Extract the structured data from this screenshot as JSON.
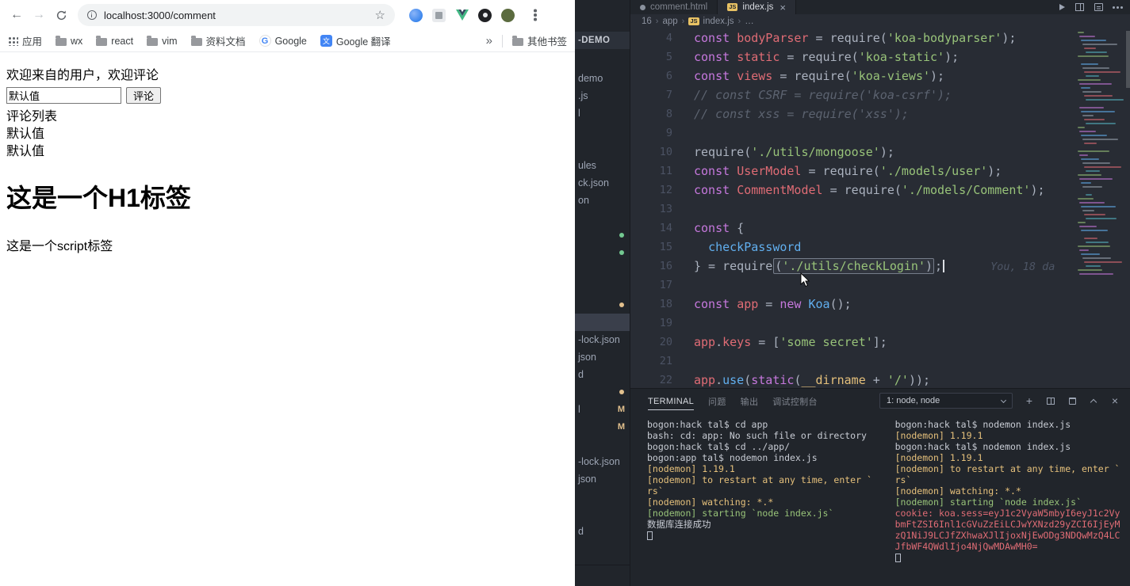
{
  "browser": {
    "toolbar": {
      "back": "←",
      "forward": "→",
      "star": "☆"
    },
    "url": "localhost:3000/comment",
    "extensions": [
      "blue-circle-extension",
      "gray-square-extension",
      "vue-devtools",
      "dark-extension",
      "profile-avatar"
    ],
    "bookmarks": {
      "items": [
        {
          "type": "apps",
          "label": "应用"
        },
        {
          "type": "folder",
          "label": "wx"
        },
        {
          "type": "folder",
          "label": "react"
        },
        {
          "type": "folder",
          "label": "vim"
        },
        {
          "type": "folder",
          "label": "资料文档"
        },
        {
          "type": "google",
          "label": "Google"
        },
        {
          "type": "translate",
          "label": "Google 翻译"
        }
      ],
      "icon_glyphs": {
        "google": "G",
        "translate": "文"
      },
      "overflow": "»",
      "others_label": "其他书签"
    },
    "page": {
      "welcome": "欢迎来自的用户，欢迎评论",
      "input_value": "默认值",
      "comment_button": "评论",
      "list_title": "评论列表",
      "comments": [
        "默认值",
        "默认值"
      ],
      "h1": "这是一个H1标签",
      "script_text": "这是一个script标签"
    }
  },
  "vscode": {
    "sidebar": {
      "header": "-DEMO",
      "rows": [
        {
          "label": "demo"
        },
        {
          "label": ".js"
        },
        {
          "label": "l"
        },
        {
          "label": ""
        },
        {
          "label": ""
        },
        {
          "label": "ules"
        },
        {
          "label": "ck.json"
        },
        {
          "label": "on"
        },
        {
          "label": ""
        },
        {
          "label": "",
          "marker": "green"
        },
        {
          "label": "",
          "marker": "green"
        },
        {
          "label": ""
        },
        {
          "label": ""
        },
        {
          "label": "",
          "marker": "yellow"
        },
        {
          "label": "",
          "selected": true
        },
        {
          "label": "-lock.json"
        },
        {
          "label": "json"
        },
        {
          "label": "d"
        },
        {
          "label": "",
          "marker": "yellow"
        },
        {
          "label": "l",
          "marker": "M"
        },
        {
          "label": "",
          "marker": "M"
        },
        {
          "label": ""
        },
        {
          "label": "-lock.json"
        },
        {
          "label": "json"
        },
        {
          "label": ""
        },
        {
          "label": ""
        },
        {
          "label": "d"
        },
        {
          "label": ""
        }
      ]
    },
    "tabs": [
      {
        "label": "comment.html",
        "icon": "dot",
        "active": false
      },
      {
        "label": "index.js",
        "icon": "js",
        "active": true,
        "close": "×"
      }
    ],
    "breadcrumb": {
      "sep": "›",
      "items": [
        "16",
        "app"
      ],
      "file_icon": "JS",
      "file": "index.js",
      "more": "…"
    },
    "editor": {
      "lines": [
        {
          "num": 4,
          "tokens": [
            [
              "kw",
              "const"
            ],
            [
              "d",
              " "
            ],
            [
              "v",
              "bodyParser"
            ],
            [
              "d",
              " = require("
            ],
            [
              "s",
              "'koa-bodyparser'"
            ],
            [
              "d",
              ");"
            ]
          ]
        },
        {
          "num": 5,
          "tokens": [
            [
              "kw",
              "const"
            ],
            [
              "d",
              " "
            ],
            [
              "v",
              "static"
            ],
            [
              "d",
              " = require("
            ],
            [
              "s",
              "'koa-static'"
            ],
            [
              "d",
              ");"
            ]
          ]
        },
        {
          "num": 6,
          "tokens": [
            [
              "kw",
              "const"
            ],
            [
              "d",
              " "
            ],
            [
              "v",
              "views"
            ],
            [
              "d",
              " = require("
            ],
            [
              "s",
              "'koa-views'"
            ],
            [
              "d",
              ");"
            ]
          ]
        },
        {
          "num": 7,
          "tokens": [
            [
              "c",
              "// const CSRF = require('koa-csrf');"
            ]
          ]
        },
        {
          "num": 8,
          "tokens": [
            [
              "c",
              "// const xss = require('xss');"
            ]
          ]
        },
        {
          "num": 9,
          "tokens": []
        },
        {
          "num": 10,
          "tokens": [
            [
              "d",
              "require("
            ],
            [
              "s",
              "'./utils/mongoose'"
            ],
            [
              "d",
              ");"
            ]
          ]
        },
        {
          "num": 11,
          "tokens": [
            [
              "kw",
              "const"
            ],
            [
              "d",
              " "
            ],
            [
              "v",
              "UserModel"
            ],
            [
              "d",
              " = require("
            ],
            [
              "s",
              "'./models/user'"
            ],
            [
              "d",
              ");"
            ]
          ]
        },
        {
          "num": 12,
          "tokens": [
            [
              "kw",
              "const"
            ],
            [
              "d",
              " "
            ],
            [
              "v",
              "CommentModel"
            ],
            [
              "d",
              " = require("
            ],
            [
              "s",
              "'./models/Comment'"
            ],
            [
              "d",
              ");"
            ]
          ]
        },
        {
          "num": 13,
          "tokens": []
        },
        {
          "num": 14,
          "tokens": [
            [
              "kw",
              "const"
            ],
            [
              "d",
              " {"
            ]
          ]
        },
        {
          "num": 15,
          "tokens": [
            [
              "d",
              "  "
            ],
            [
              "fn",
              "checkPassword"
            ]
          ]
        },
        {
          "num": 16,
          "tokens": [
            [
              "d",
              "} = require"
            ],
            [
              "grp",
              [
                [
                  "d",
                  "("
                ],
                [
                  "s",
                  "'./utils/checkLogin'"
                ],
                [
                  "d",
                  ")"
                ]
              ]
            ],
            [
              "d",
              ";"
            ],
            [
              "caret",
              ""
            ],
            [
              "blame",
              "You, 18 da"
            ]
          ]
        },
        {
          "num": 17,
          "tokens": []
        },
        {
          "num": 18,
          "tokens": [
            [
              "kw",
              "const"
            ],
            [
              "d",
              " "
            ],
            [
              "v",
              "app"
            ],
            [
              "d",
              " = "
            ],
            [
              "kw",
              "new"
            ],
            [
              "d",
              " "
            ],
            [
              "fn",
              "Koa"
            ],
            [
              "d",
              "();"
            ]
          ]
        },
        {
          "num": 19,
          "tokens": []
        },
        {
          "num": 20,
          "tokens": [
            [
              "v",
              "app"
            ],
            [
              "d",
              "."
            ],
            [
              "v",
              "keys"
            ],
            [
              "d",
              " = ["
            ],
            [
              "s",
              "'some secret'"
            ],
            [
              "d",
              "];"
            ]
          ]
        },
        {
          "num": 21,
          "tokens": []
        },
        {
          "num": 22,
          "tokens": [
            [
              "v",
              "app"
            ],
            [
              "d",
              "."
            ],
            [
              "fn",
              "use"
            ],
            [
              "d",
              "("
            ],
            [
              "kw",
              "static"
            ],
            [
              "d",
              "("
            ],
            [
              "cl",
              "__dirname"
            ],
            [
              "d",
              " + "
            ],
            [
              "s",
              "'/'"
            ],
            [
              "d",
              "));"
            ]
          ]
        }
      ]
    },
    "terminal": {
      "tabs": [
        {
          "label": "TERMINAL",
          "active": true
        },
        {
          "label": "问题"
        },
        {
          "label": "输出"
        },
        {
          "label": "调试控制台"
        }
      ],
      "dropdown": "1: node, node",
      "left": [
        {
          "c": "fg",
          "t": "bogon:hack tal$ cd app"
        },
        {
          "c": "fg",
          "t": "bash: cd: app: No such file or directory"
        },
        {
          "c": "fg",
          "t": "bogon:hack tal$ cd ../app/"
        },
        {
          "c": "fg",
          "t": "bogon:app tal$ nodemon index.js"
        },
        {
          "c": "y",
          "t": "[nodemon] 1.19.1"
        },
        {
          "c": "y",
          "t": "[nodemon] to restart at any time, enter `"
        },
        {
          "c": "y",
          "t": "rs`"
        },
        {
          "c": "y",
          "t": "[nodemon] watching: *.*"
        },
        {
          "c": "g",
          "t": "[nodemon] starting `node index.js`"
        },
        {
          "c": "fg",
          "t": "数据库连接成功"
        },
        {
          "c": "cursor",
          "t": ""
        }
      ],
      "right": [
        {
          "c": "fg",
          "t": "bogon:hack tal$ nodemon index.js"
        },
        {
          "c": "y",
          "t": "[nodemon] 1.19.1"
        },
        {
          "c": "fg",
          "t": "bogon:hack tal$ nodemon index.js"
        },
        {
          "c": "y",
          "t": "[nodemon] 1.19.1"
        },
        {
          "c": "y",
          "t": "[nodemon] to restart at any time, enter `"
        },
        {
          "c": "y",
          "t": "rs`"
        },
        {
          "c": "y",
          "t": "[nodemon] watching: *.*"
        },
        {
          "c": "g",
          "t": "[nodemon] starting `node index.js`"
        },
        {
          "c": "r",
          "t": "cookie: koa.sess=eyJ1c2VyaW5mbyI6eyJ1c2Vy"
        },
        {
          "c": "r",
          "t": "bmFtZSI6Inl1cGVuZzEiLCJwYXNzd29yZCI6IjEyM"
        },
        {
          "c": "r",
          "t": "zQ1NiJ9LCJfZXhwaXJlIjoxNjEwODg3NDQwMzQ4LC"
        },
        {
          "c": "r",
          "t": "JfbWF4QWdlIjo4NjQwMDAwMH0="
        },
        {
          "c": "cursor",
          "t": ""
        }
      ]
    },
    "icons": {
      "close": "×",
      "plus": "+"
    }
  },
  "colors": {
    "keyword": "#c678dd",
    "variable": "#e06c75",
    "string": "#98c379",
    "function_blue": "#61afef",
    "comment": "#5c6370",
    "warn_yellow": "#e5c07b",
    "ok_green": "#98c379",
    "error_red": "#e06c75",
    "editor_bg": "#282c34",
    "panel_bg": "#21252b"
  }
}
